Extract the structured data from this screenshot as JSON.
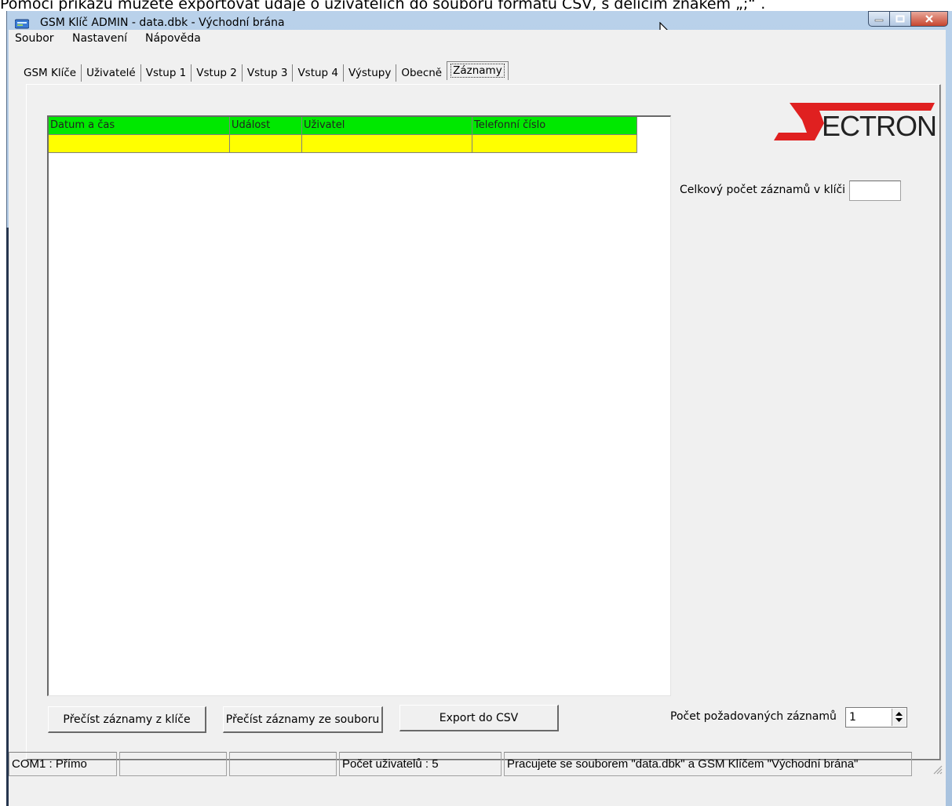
{
  "doc_caption": "Pomocí příkazu můžete exportovat údaje o uživatelích do souboru formátu CSV, s dělicím znakem „;“ .",
  "window": {
    "title": "GSM Klíč ADMIN - data.dbk - Východní brána"
  },
  "menu": {
    "file": "Soubor",
    "settings": "Nastavení",
    "help": "Nápověda"
  },
  "tabs": [
    "GSM Klíče",
    "Uživatelé",
    "Vstup 1",
    "Vstup 2",
    "Vstup 3",
    "Vstup 4",
    "Výstupy",
    "Obecně",
    "Záznamy"
  ],
  "active_tab": "Záznamy",
  "grid": {
    "columns": [
      "Datum a čas",
      "Událost",
      "Uživatel",
      "Telefonní číslo"
    ],
    "rows": [
      [
        "",
        "",
        "",
        ""
      ]
    ]
  },
  "logo": {
    "text": "ECTRON",
    "accent_color": "#e02020"
  },
  "total_records": {
    "label": "Celkový počet záznamů v klíči",
    "value": ""
  },
  "buttons": {
    "read_from_key": "Přečíst záznamy z klíče",
    "read_from_file": "Přečíst záznamy ze souboru",
    "export_csv": "Export do CSV"
  },
  "requested_records": {
    "label": "Počet požadovaných záznamů",
    "value": "1"
  },
  "status": {
    "port": "COM1 : Přímo",
    "seg2": "",
    "seg3": "",
    "users": "Počet uživatelů : 5",
    "message": "Pracujete se souborem \"data.dbk\" a GSM Klíčem \"Východní brána\""
  },
  "colors": {
    "header_green": "#00e800",
    "row_yellow": "#ffff00"
  }
}
